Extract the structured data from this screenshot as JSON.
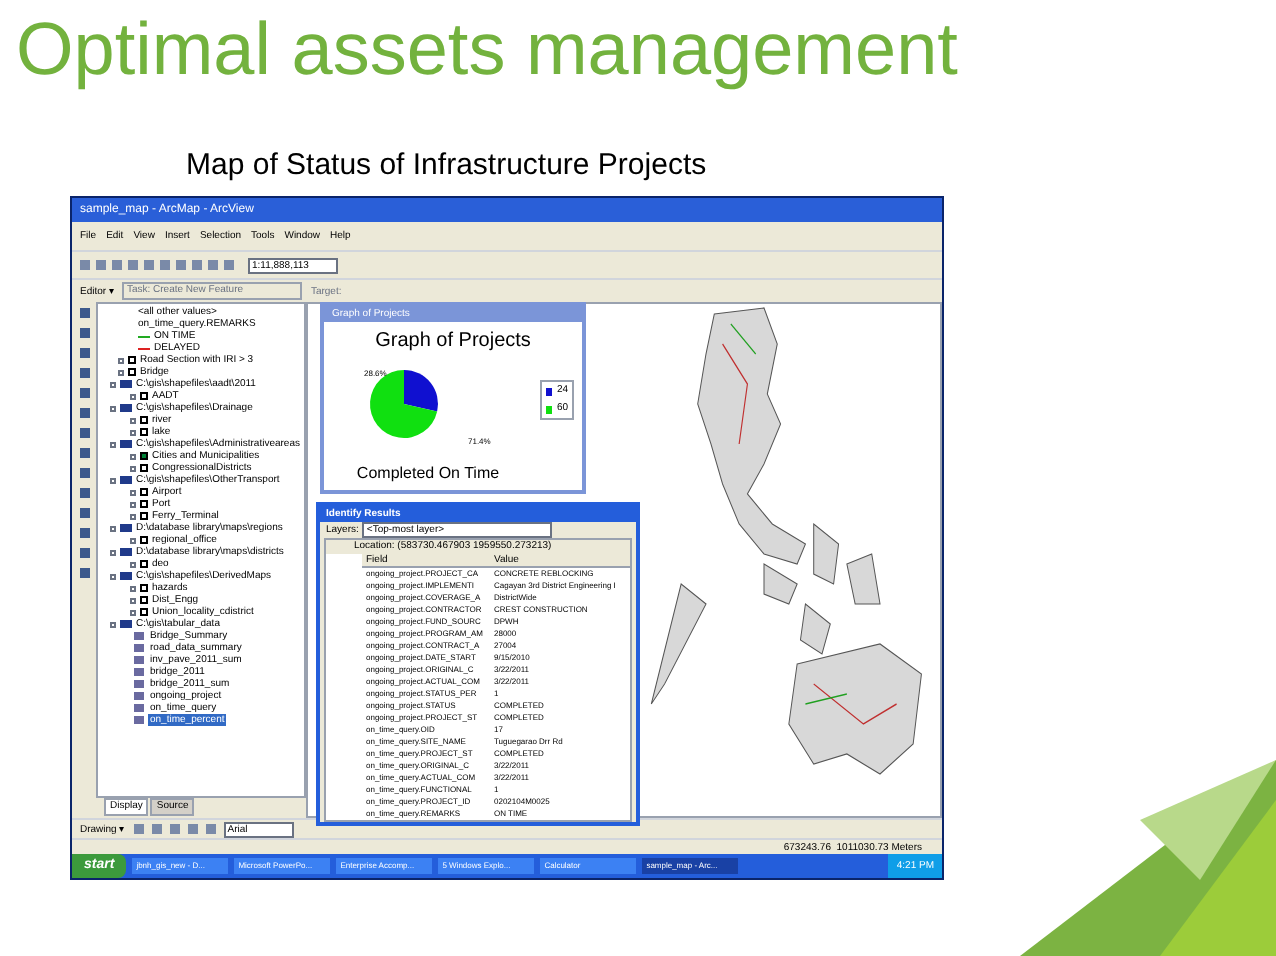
{
  "slide": {
    "title": "Optimal assets management",
    "subtitle": "Map of Status of Infrastructure Projects"
  },
  "window": {
    "title": "sample_map - ArcMap - ArcView"
  },
  "menu": [
    "File",
    "Edit",
    "View",
    "Insert",
    "Selection",
    "Tools",
    "Window",
    "Help"
  ],
  "toolbar": {
    "scale": "1:11,888,113",
    "editor": "Editor ▾",
    "task": "Task: Create New Feature",
    "target": "Target:"
  },
  "toc": [
    {
      "kind": "legend",
      "label": "<all other values>"
    },
    {
      "kind": "legend",
      "label": "on_time_query.REMARKS"
    },
    {
      "kind": "legend",
      "label": "ON TIME",
      "color": "#22aa22"
    },
    {
      "kind": "legend",
      "label": "DELAYED",
      "color": "#dd2222"
    },
    {
      "kind": "layer",
      "label": "Road Section with IRI > 3",
      "checked": false
    },
    {
      "kind": "layer",
      "label": "Bridge",
      "checked": false
    },
    {
      "kind": "group",
      "label": "C:\\gis\\shapefiles\\aadt\\2011",
      "children": [
        {
          "kind": "layer",
          "label": "AADT",
          "checked": false
        }
      ]
    },
    {
      "kind": "group",
      "label": "C:\\gis\\shapefiles\\Drainage",
      "children": [
        {
          "kind": "layer",
          "label": "river",
          "checked": false
        },
        {
          "kind": "layer",
          "label": "lake",
          "checked": false
        }
      ]
    },
    {
      "kind": "group",
      "label": "C:\\gis\\shapefiles\\Administrativeareas",
      "children": [
        {
          "kind": "layer",
          "label": "Cities and Municipalities",
          "checked": true
        },
        {
          "kind": "layer",
          "label": "CongressionalDistricts",
          "checked": false
        }
      ]
    },
    {
      "kind": "group",
      "label": "C:\\gis\\shapefiles\\OtherTransport",
      "children": [
        {
          "kind": "layer",
          "label": "Airport",
          "checked": false
        },
        {
          "kind": "layer",
          "label": "Port",
          "checked": false
        },
        {
          "kind": "layer",
          "label": "Ferry_Terminal",
          "checked": false
        }
      ]
    },
    {
      "kind": "group",
      "label": "D:\\database library\\maps\\regions",
      "children": [
        {
          "kind": "layer",
          "label": "regional_office",
          "checked": false
        }
      ]
    },
    {
      "kind": "group",
      "label": "D:\\database library\\maps\\districts",
      "children": [
        {
          "kind": "layer",
          "label": "deo",
          "checked": false
        }
      ]
    },
    {
      "kind": "group",
      "label": "C:\\gis\\shapefiles\\DerivedMaps",
      "children": [
        {
          "kind": "layer",
          "label": "hazards",
          "checked": false
        },
        {
          "kind": "layer",
          "label": "Dist_Engg",
          "checked": false
        },
        {
          "kind": "layer",
          "label": "Union_locality_cdistrict",
          "checked": false
        }
      ]
    },
    {
      "kind": "group",
      "label": "C:\\gis\\tabular_data",
      "children": [
        {
          "kind": "table",
          "label": "Bridge_Summary",
          "selected": false
        },
        {
          "kind": "table",
          "label": "road_data_summary",
          "selected": false
        },
        {
          "kind": "table",
          "label": "inv_pave_2011_sum",
          "selected": false
        },
        {
          "kind": "table",
          "label": "bridge_2011",
          "selected": false
        },
        {
          "kind": "table",
          "label": "bridge_2011_sum",
          "selected": false
        },
        {
          "kind": "table",
          "label": "ongoing_project",
          "selected": false
        },
        {
          "kind": "table",
          "label": "on_time_query",
          "selected": false
        },
        {
          "kind": "table",
          "label": "on_time_percent",
          "selected": true
        }
      ]
    }
  ],
  "toc_tabs": [
    {
      "label": "Display",
      "selected": true
    },
    {
      "label": "Source",
      "selected": false
    }
  ],
  "graph_window": {
    "title": "Graph of Projects",
    "chart_data": {
      "type": "pie",
      "title": "Graph of Projects",
      "categories": [
        "24",
        "60"
      ],
      "colors": [
        "#1010d0",
        "#10e010"
      ],
      "series": [
        {
          "name": "Completed On Time",
          "values": [
            24,
            60
          ]
        }
      ],
      "value_labels": [
        "28.6%",
        "71.4%"
      ],
      "legend": "right"
    }
  },
  "identify": {
    "title": "Identify Results",
    "layers_label": "Layers:",
    "layers_value": "<Top-most layer>",
    "location": "Location: (583730.467903 1959550.273213)",
    "columns": [
      "Field",
      "Value"
    ],
    "rows": [
      [
        "ongoing_project.PROJECT_CA",
        "CONCRETE REBLOCKING"
      ],
      [
        "ongoing_project.IMPLEMENTI",
        "Cagayan 3rd District Engineering I"
      ],
      [
        "ongoing_project.COVERAGE_A",
        "DistrictWide"
      ],
      [
        "ongoing_project.CONTRACTOR",
        "CREST CONSTRUCTION"
      ],
      [
        "ongoing_project.FUND_SOURC",
        "DPWH"
      ],
      [
        "ongoing_project.PROGRAM_AM",
        "28000"
      ],
      [
        "ongoing_project.CONTRACT_A",
        "27004"
      ],
      [
        "ongoing_project.DATE_START",
        "9/15/2010"
      ],
      [
        "ongoing_project.ORIGINAL_C",
        "3/22/2011"
      ],
      [
        "ongoing_project.ACTUAL_COM",
        "3/22/2011"
      ],
      [
        "ongoing_project.STATUS_PER",
        "1"
      ],
      [
        "ongoing_project.STATUS",
        "COMPLETED"
      ],
      [
        "ongoing_project.PROJECT_ST",
        "COMPLETED"
      ],
      [
        "on_time_query.OID",
        "17"
      ],
      [
        "on_time_query.SITE_NAME",
        "Tuguegarao Drr Rd"
      ],
      [
        "on_time_query.PROJECT_ST",
        "COMPLETED"
      ],
      [
        "on_time_query.ORIGINAL_C",
        "3/22/2011"
      ],
      [
        "on_time_query.ACTUAL_COM",
        "3/22/2011"
      ],
      [
        "on_time_query.FUNCTIONAL",
        "1"
      ],
      [
        "on_time_query.PROJECT_ID",
        "0202104M0025"
      ],
      [
        "on_time_query.REMARKS",
        "ON TIME"
      ]
    ]
  },
  "drawing_toolbar": {
    "drawing": "Drawing ▾",
    "font": "Arial"
  },
  "status_bar": "673243.76  1011030.73 Meters",
  "taskbar": {
    "start": "start",
    "items": [
      {
        "label": "jbnh_gis_new - D...",
        "selected": false
      },
      {
        "label": "Microsoft PowerPo...",
        "selected": false
      },
      {
        "label": "Enterprise Accomp...",
        "selected": false
      },
      {
        "label": "5 Windows Explo...",
        "selected": false
      },
      {
        "label": "Calculator",
        "selected": false
      },
      {
        "label": "sample_map - Arc...",
        "selected": true
      }
    ],
    "clock": "4:21 PM"
  }
}
